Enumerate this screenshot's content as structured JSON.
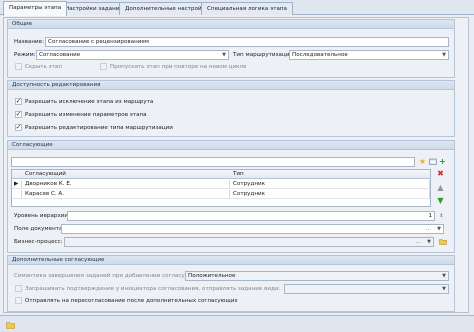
{
  "tabs": [
    {
      "label": "Параметры этапа"
    },
    {
      "label": "Настройки заданий"
    },
    {
      "label": "Дополнительные настройки"
    },
    {
      "label": "Специальная логика этапа"
    }
  ],
  "general": {
    "header": "Общие",
    "name_label": "Название:",
    "name_value": "Согласование с рецензированием",
    "mode_label": "Режим:",
    "mode_value": "Согласование",
    "route_type_label": "Тип маршрутизации:",
    "route_type_value": "Последовательное",
    "hide_stage_label": "Скрыть этап",
    "skip_stage_label": "Пропускать этап при повторе на новом цикле"
  },
  "edit_access": {
    "header": "Доступность редактирования",
    "items": [
      {
        "label": "Разрешить исключение этапа из маршрута",
        "checked": true
      },
      {
        "label": "Разрешить изменение параметров этапа",
        "checked": true
      },
      {
        "label": "Разрешить редактирование типа маршрутизации",
        "checked": true
      }
    ]
  },
  "approvers": {
    "header": "Согласующие",
    "columns": [
      "Согласующий",
      "Тип"
    ],
    "rows": [
      {
        "name": "Дворников К. Е.",
        "type": "Сотрудник",
        "current": "▶"
      },
      {
        "name": "Карасев С. А.",
        "type": "Сотрудник",
        "current": ""
      }
    ],
    "level_label": "Уровень иерархии:",
    "level_value": "1",
    "doc_field_label": "Поле документа:",
    "business_process_label": "Бизнес-процесс:",
    "ellipsis": "..."
  },
  "extra": {
    "header": "Дополнительные согласующие",
    "semantics_label": "Семантика завершения заданий при добавлении согласующих:",
    "semantics_value": "Положительное",
    "request_confirm_label": "Запрашивать подтверждение у инициатора согласования, отправлять задание вида:",
    "resend_label": "Отправлять на пересогласование после дополнительных согласующих"
  },
  "icons": {
    "folder": "folder-icon",
    "star": "star-icon",
    "add": "add-icon",
    "delete": "delete-icon",
    "up": "arrow-up-icon",
    "down": "arrow-down-icon"
  },
  "colors": {
    "delete": "#c0392b",
    "up": "#8d97a3",
    "down": "#2e9a2e",
    "star": "#e8b41c",
    "add": "#3a8f3a"
  }
}
